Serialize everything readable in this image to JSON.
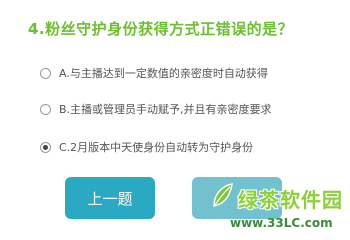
{
  "question": {
    "title": "4.粉丝守护身份获得方式正错误的是？"
  },
  "options": [
    {
      "label": "A.与主播达到一定数值的亲密度时自动获得",
      "selected": false
    },
    {
      "label": "B.主播或管理员手动赋予,并且有亲密度要求",
      "selected": false
    },
    {
      "label": "C.2月版本中天使身份自动转为守护身份",
      "selected": true
    }
  ],
  "navigation": {
    "prev_label": "上一题",
    "next_label": ""
  },
  "watermark": {
    "brand": "绿茶软件园",
    "url": "www.33LC.com"
  },
  "colors": {
    "title": "#6cbf2f",
    "button": "#29a9c2"
  }
}
